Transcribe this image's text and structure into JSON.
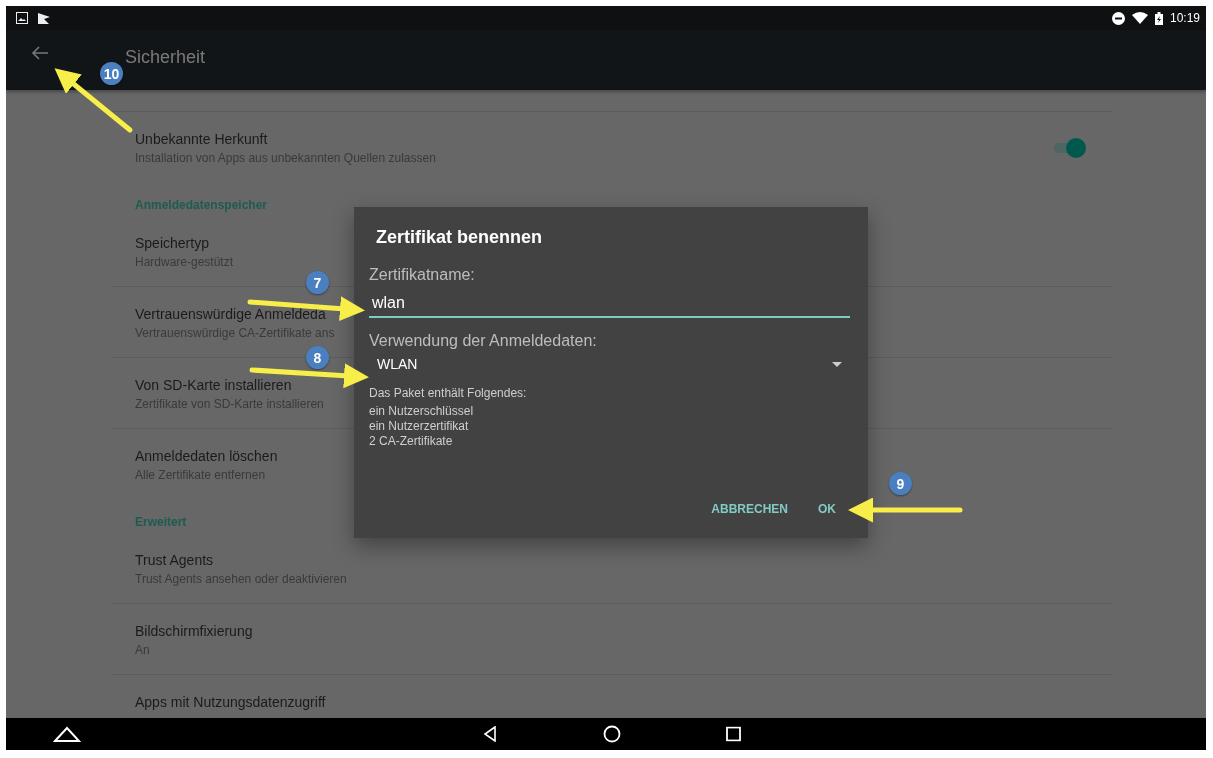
{
  "status_bar": {
    "time": "10:19"
  },
  "toolbar": {
    "title": "Sicherheit"
  },
  "settings": [
    {
      "kind": "item",
      "title": "Unbekannte Herkunft",
      "subtitle": "Installation von Apps aus unbekannten Quellen zulassen",
      "toggle": {
        "on": true
      }
    },
    {
      "kind": "header",
      "title": "Anmeldedatenspeicher"
    },
    {
      "kind": "item",
      "title": "Speichertyp",
      "subtitle": "Hardware-gestützt"
    },
    {
      "kind": "item",
      "title": "Vertrauenswürdige Anmeldeda",
      "subtitle": "Vertrauenswürdige CA-Zertifikate ans"
    },
    {
      "kind": "item",
      "title": "Von SD-Karte installieren",
      "subtitle": "Zertifikate von SD-Karte installieren"
    },
    {
      "kind": "item",
      "title": "Anmeldedaten löschen",
      "subtitle": "Alle Zertifikate entfernen"
    },
    {
      "kind": "header",
      "title": "Erweitert"
    },
    {
      "kind": "item",
      "title": "Trust Agents",
      "subtitle": "Trust Agents ansehen oder deaktivieren"
    },
    {
      "kind": "item",
      "title": "Bildschirmfixierung",
      "subtitle": "An"
    },
    {
      "kind": "item",
      "title": "Apps mit Nutzungsdatenzugriff"
    }
  ],
  "dialog": {
    "title": "Zertifikat benennen",
    "name_label": "Zertifikatname:",
    "name_value": "wlan",
    "usage_label": "Verwendung der Anmeldedaten:",
    "usage_value": "WLAN",
    "package_heading": "Das Paket enthält Folgendes:",
    "package_items": [
      "ein Nutzerschlüssel",
      "ein Nutzerzertifikat",
      "2 CA-Zertifikate"
    ],
    "buttons": [
      "ABBRECHEN",
      "OK"
    ]
  },
  "annotations": [
    {
      "label": "10"
    },
    {
      "label": "7"
    },
    {
      "label": "8"
    },
    {
      "label": "9"
    }
  ]
}
